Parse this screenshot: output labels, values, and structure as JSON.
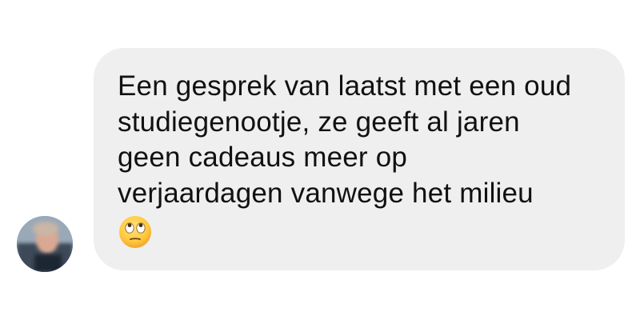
{
  "conversation": {
    "message": {
      "lines": [
        "Een gesprek van laatst met een oud",
        "studiegenootje, ze geeft al jaren",
        "geen cadeaus meer op",
        "verjaardagen vanwege het milieu"
      ],
      "emoji": "face-with-rolling-eyes",
      "bubble_color": "#efefef",
      "text_color": "#111111"
    },
    "sender": {
      "avatar": "blurred-profile-photo"
    }
  }
}
